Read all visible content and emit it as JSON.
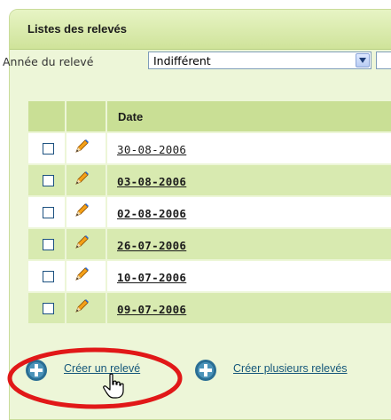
{
  "panel": {
    "title": "Listes des relevés"
  },
  "filter": {
    "label": "Année du relevé",
    "selected": "Indifférent"
  },
  "table": {
    "header": {
      "date": "Date"
    },
    "rows": [
      {
        "date": "30-08-2006",
        "bold": false
      },
      {
        "date": "03-08-2006",
        "bold": true
      },
      {
        "date": "02-08-2006",
        "bold": true
      },
      {
        "date": "26-07-2006",
        "bold": true
      },
      {
        "date": "10-07-2006",
        "bold": true
      },
      {
        "date": "09-07-2006",
        "bold": true
      }
    ]
  },
  "actions": {
    "create_one": "Créer un relevé",
    "create_many": "Créer plusieurs relevés"
  },
  "icons": {
    "edit": "pencil-icon",
    "add": "plus-circle-icon",
    "dropdown": "chevron-down-icon",
    "cursor": "hand-pointer-icon"
  },
  "colors": {
    "panel_bg": "#edf6d8",
    "header_row": "#c9df95",
    "alt_row": "#d8eab0",
    "link": "#15577a",
    "highlight": "#e11818"
  }
}
